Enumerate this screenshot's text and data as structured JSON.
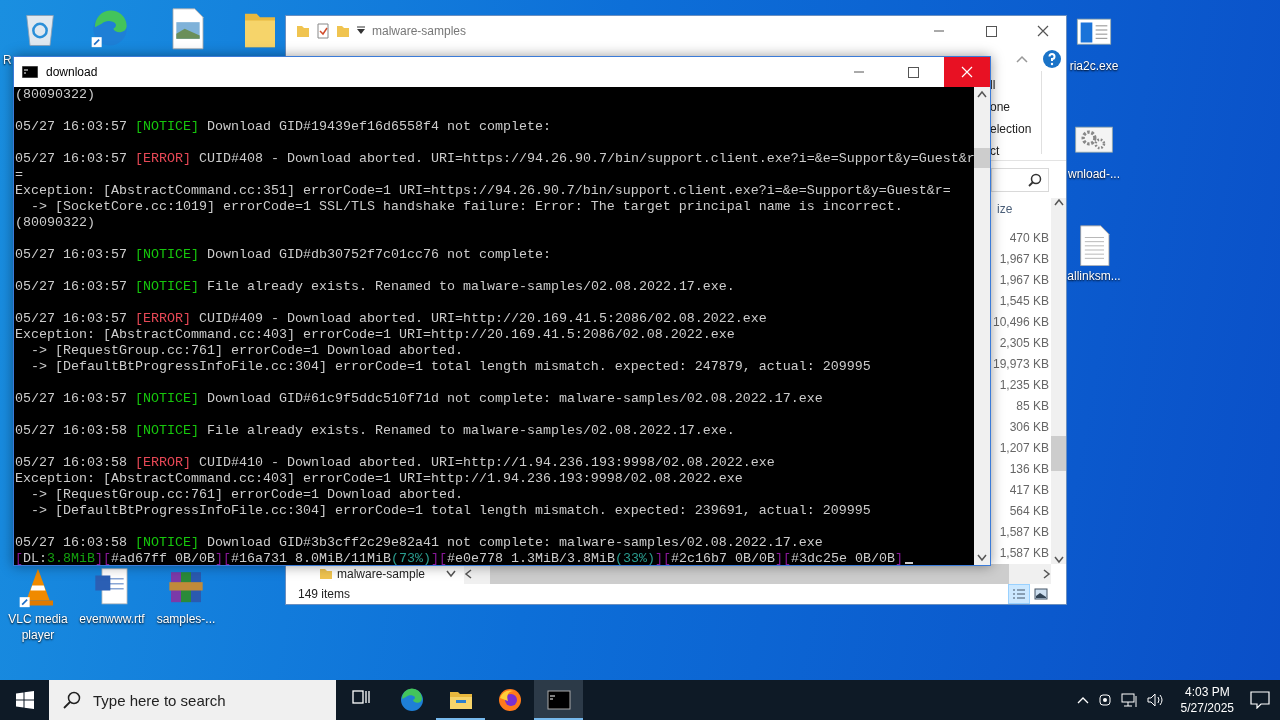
{
  "desktop_icons": [
    {
      "kind": "recycle",
      "label": "R"
    },
    {
      "kind": "edge"
    },
    {
      "kind": "image"
    },
    {
      "kind": "folder"
    },
    {
      "kind": "exe",
      "label": "ria2c.exe"
    },
    {
      "kind": "gears",
      "label": "wnload-..."
    },
    {
      "kind": "text",
      "label": "allinksm..."
    },
    {
      "kind": "vlc",
      "label": "VLC media player"
    },
    {
      "kind": "word",
      "label": "evenwww.rtf"
    },
    {
      "kind": "archive",
      "label": "samples-..."
    }
  ],
  "explorer": {
    "title": "malware-samples",
    "ribbon_items": [
      "ll",
      "one",
      "election",
      "ct"
    ],
    "column_header": "ize",
    "sizes": [
      "470 KB",
      "1,967 KB",
      "1,967 KB",
      "1,545 KB",
      "10,496 KB",
      "2,305 KB",
      "19,973 KB",
      "1,235 KB",
      "85 KB",
      "306 KB",
      "1,207 KB",
      "136 KB",
      "417 KB",
      "564 KB",
      "1,587 KB",
      "1,587 KB"
    ],
    "nav_item": "malware-sample",
    "status": "149 items"
  },
  "console": {
    "title": "download",
    "entries": [
      {
        "lines": [
          {
            "text": "(80090322)"
          }
        ]
      },
      {
        "lines": [
          {
            "time": "05/27 16:03:57",
            "tag": "[NOTICE]",
            "kind": "notice",
            "text": "Download GID#19439ef16d6558f4 not complete:"
          }
        ]
      },
      {
        "lines": [
          {
            "time": "05/27 16:03:57",
            "tag": "[ERROR]",
            "kind": "error",
            "text": "CUID#408 - Download aborted. URI=https://94.26.90.7/bin/support.client.exe?i=&e=Support&y=Guest&r"
          },
          {
            "text": "="
          },
          {
            "text": "Exception: [AbstractCommand.cc:351] errorCode=1 URI=https://94.26.90.7/bin/support.client.exe?i=&e=Support&y=Guest&r="
          },
          {
            "text": "  -> [SocketCore.cc:1019] errorCode=1 SSL/TLS handshake failure: Error: The target principal name is incorrect."
          },
          {
            "text": "(80090322)"
          }
        ]
      },
      {
        "lines": [
          {
            "time": "05/27 16:03:57",
            "tag": "[NOTICE]",
            "kind": "notice",
            "text": "Download GID#db30752f7c01cc76 not complete:"
          }
        ]
      },
      {
        "lines": [
          {
            "time": "05/27 16:03:57",
            "tag": "[NOTICE]",
            "kind": "notice",
            "text": "File already exists. Renamed to malware-samples/02.08.2022.17.exe."
          }
        ]
      },
      {
        "lines": [
          {
            "time": "05/27 16:03:57",
            "tag": "[ERROR]",
            "kind": "error",
            "text": "CUID#409 - Download aborted. URI=http://20.169.41.5:2086/02.08.2022.exe"
          },
          {
            "text": "Exception: [AbstractCommand.cc:403] errorCode=1 URI=http://20.169.41.5:2086/02.08.2022.exe"
          },
          {
            "text": "  -> [RequestGroup.cc:761] errorCode=1 Download aborted."
          },
          {
            "text": "  -> [DefaultBtProgressInfoFile.cc:304] errorCode=1 total length mismatch. expected: 247879, actual: 209995"
          }
        ]
      },
      {
        "lines": [
          {
            "time": "05/27 16:03:57",
            "tag": "[NOTICE]",
            "kind": "notice",
            "text": "Download GID#61c9f5ddc510f71d not complete: malware-samples/02.08.2022.17.exe"
          }
        ]
      },
      {
        "lines": [
          {
            "time": "05/27 16:03:58",
            "tag": "[NOTICE]",
            "kind": "notice",
            "text": "File already exists. Renamed to malware-samples/02.08.2022.17.exe."
          }
        ]
      },
      {
        "lines": [
          {
            "time": "05/27 16:03:58",
            "tag": "[ERROR]",
            "kind": "error",
            "text": "CUID#410 - Download aborted. URI=http://1.94.236.193:9998/02.08.2022.exe"
          },
          {
            "text": "Exception: [AbstractCommand.cc:403] errorCode=1 URI=http://1.94.236.193:9998/02.08.2022.exe"
          },
          {
            "text": "  -> [RequestGroup.cc:761] errorCode=1 Download aborted."
          },
          {
            "text": "  -> [DefaultBtProgressInfoFile.cc:304] errorCode=1 total length mismatch. expected: 239691, actual: 209995"
          }
        ]
      },
      {
        "lines": [
          {
            "time": "05/27 16:03:58",
            "tag": "[NOTICE]",
            "kind": "notice",
            "text": "Download GID#3b3cff2c29e82a41 not complete: malware-samples/02.08.2022.17.exe"
          }
        ]
      }
    ],
    "progress": [
      {
        "text": "[",
        "kind": "bracket"
      },
      {
        "text": "DL:",
        "kind": "plain"
      },
      {
        "text": "3.8MiB",
        "kind": "speed"
      },
      {
        "text": "][",
        "kind": "bracket"
      },
      {
        "text": "#ad67ff 0B/0B",
        "kind": "plain"
      },
      {
        "text": "][",
        "kind": "bracket"
      },
      {
        "text": "#16a731 8.0MiB/11MiB",
        "kind": "plain"
      },
      {
        "text": "(73%)",
        "kind": "percent"
      },
      {
        "text": "][",
        "kind": "bracket"
      },
      {
        "text": "#e0e778 1.3MiB/3.8MiB",
        "kind": "plain"
      },
      {
        "text": "(33%)",
        "kind": "percent"
      },
      {
        "text": "][",
        "kind": "bracket"
      },
      {
        "text": "#2c16b7 0B/0B",
        "kind": "plain"
      },
      {
        "text": "][",
        "kind": "bracket"
      },
      {
        "text": "#3dc25e 0B/0B",
        "kind": "plain"
      },
      {
        "text": "]",
        "kind": "bracket"
      }
    ]
  },
  "taskbar": {
    "search": {
      "placeholder": "Type here to search"
    },
    "apps": [
      {
        "kind": "taskview",
        "selected": false,
        "running": false
      },
      {
        "kind": "edge",
        "selected": false,
        "running": false
      },
      {
        "kind": "explorer",
        "selected": false,
        "running": true
      },
      {
        "kind": "firefox",
        "selected": false,
        "running": false
      },
      {
        "kind": "console",
        "selected": true,
        "running": true
      }
    ],
    "time": "4:03 PM",
    "date": "5/27/2025"
  }
}
